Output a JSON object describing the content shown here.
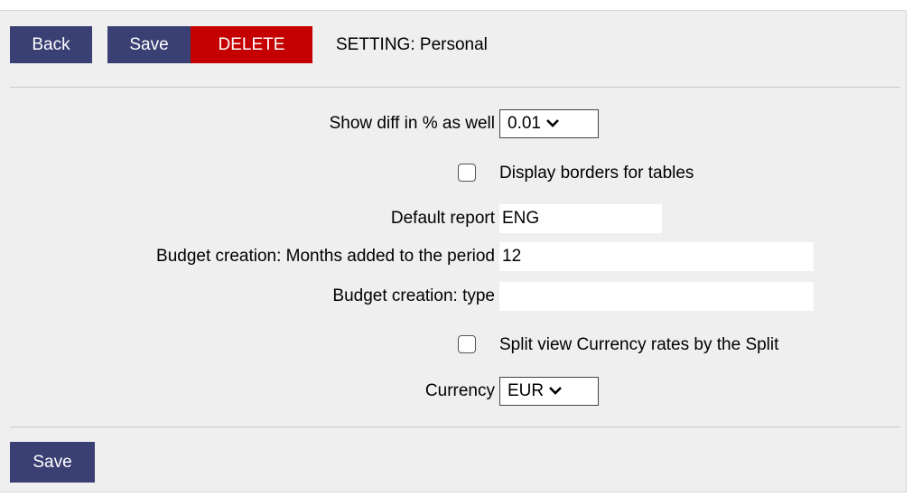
{
  "toolbar": {
    "back_label": "Back",
    "save_label": "Save",
    "delete_label": "DELETE",
    "title": "SETTING: Personal"
  },
  "colors": {
    "button_blue": "#3a4073",
    "button_red": "#c40000",
    "panel_background": "#efefef"
  },
  "form": {
    "show_diff": {
      "label": "Show diff in % as well",
      "value": "0.01"
    },
    "display_borders": {
      "label": "Display borders for tables",
      "checked": false
    },
    "default_report": {
      "label": "Default report",
      "value": "ENG"
    },
    "budget_months": {
      "label": "Budget creation: Months added to the period",
      "value": "12"
    },
    "budget_type": {
      "label": "Budget creation: type",
      "value": ""
    },
    "split_view": {
      "label": "Split view Currency rates by the Split",
      "checked": false
    },
    "currency": {
      "label": "Currency",
      "value": "EUR"
    }
  },
  "footer": {
    "save_label": "Save"
  }
}
